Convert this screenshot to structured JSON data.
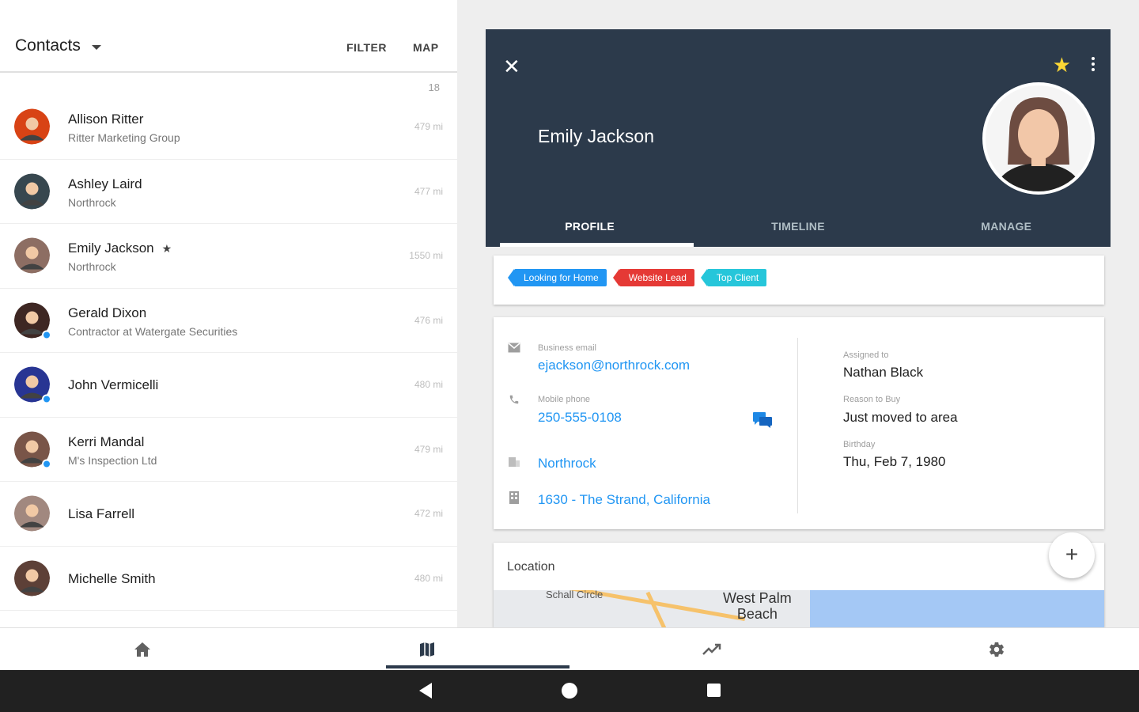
{
  "left": {
    "title": "Contacts",
    "filter_label": "FILTER",
    "map_label": "MAP",
    "count": "18"
  },
  "contacts": [
    {
      "name": "Allison Ritter",
      "company": "Ritter Marketing Group",
      "distance": "479 mi",
      "color": "#d84315",
      "favorite": false,
      "online": false
    },
    {
      "name": "Ashley Laird",
      "company": "Northrock",
      "distance": "477 mi",
      "color": "#37474f",
      "favorite": false,
      "online": false
    },
    {
      "name": "Emily Jackson",
      "company": "Northrock",
      "distance": "1550 mi",
      "color": "#8d6e63",
      "favorite": true,
      "online": false
    },
    {
      "name": "Gerald Dixon",
      "company": "Contractor at Watergate Securities",
      "distance": "476 mi",
      "color": "#3e2723",
      "favorite": false,
      "online": true
    },
    {
      "name": "John Vermicelli",
      "company": "",
      "distance": "480 mi",
      "color": "#283593",
      "favorite": false,
      "online": true
    },
    {
      "name": "Kerri Mandal",
      "company": "M's Inspection Ltd",
      "distance": "479 mi",
      "color": "#795548",
      "favorite": false,
      "online": true
    },
    {
      "name": "Lisa Farrell",
      "company": "",
      "distance": "472 mi",
      "color": "#a1887f",
      "favorite": false,
      "online": false
    },
    {
      "name": "Michelle Smith",
      "company": "",
      "distance": "480 mi",
      "color": "#5d4037",
      "favorite": false,
      "online": false
    }
  ],
  "detail": {
    "name": "Emily Jackson",
    "tabs": [
      "PROFILE",
      "TIMELINE",
      "MANAGE"
    ],
    "tags": [
      {
        "label": "Looking for Home",
        "color": "#2196f3"
      },
      {
        "label": "Website Lead",
        "color": "#e53935"
      },
      {
        "label": "Top Client",
        "color": "#26c6da"
      }
    ],
    "email_label": "Business email",
    "email": "ejackson@northrock.com",
    "phone_label": "Mobile phone",
    "phone": "250-555-0108",
    "company": "Northrock",
    "address": "1630 - The Strand, California",
    "assigned_label": "Assigned to",
    "assigned": "Nathan Black",
    "reason_label": "Reason to Buy",
    "reason": "Just moved to area",
    "birthday_label": "Birthday",
    "birthday": "Thu, Feb 7, 1980",
    "location_title": "Location",
    "map_street": "Schall Circle",
    "map_city_1": "West Palm",
    "map_city_2": "Beach"
  },
  "accent_color": "#2c3a4b",
  "link_color": "#2196f3"
}
